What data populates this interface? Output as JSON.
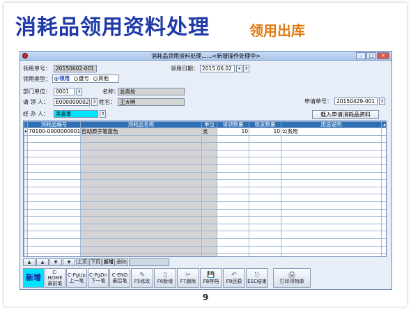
{
  "slide": {
    "title": "消耗品领用资料处理",
    "subtitle": "领用出库",
    "page_number": "9"
  },
  "window": {
    "title": "消耗品领用资料处理......<新增操作处理中>",
    "controls": [
      "minimize-icon",
      "maximize-icon",
      "close-icon"
    ]
  },
  "form": {
    "req_no_label": "领用单号：",
    "req_no_value": "20150602-001",
    "date_label": "领用日期：",
    "date_value": "2015.06.02",
    "type_label": "领用类型：",
    "types": [
      "领用",
      "盘亏",
      "其他"
    ],
    "type_selected": "领用",
    "dept_label": "部门单位：",
    "dept_code": "0001",
    "name_label": "名称：",
    "dept_name": "总务处",
    "applicant_label": "请 领 人：",
    "applicant_code": "E000000002",
    "applicant_name_label": "姓名：",
    "applicant_name": "王大明",
    "handler_label": "经 办 人：",
    "handler_value": "吴嘉豪",
    "apply_no_label": "申请单号：",
    "apply_no_value": "20150429-001",
    "import_button": "载入申请消耗品资料"
  },
  "grid": {
    "columns": [
      "消耗品编号",
      "消耗品名称",
      "单位",
      "请领数量",
      "核发数量",
      "用途说明"
    ],
    "rows": [
      [
        "70100-0000000001",
        "自动原子笔蓝色",
        "支",
        "10",
        "10",
        "公务用"
      ]
    ],
    "empty_rows": 17
  },
  "nav": {
    "arrows": [
      "▲",
      "▲",
      "▼",
      "▼"
    ],
    "page_up": "上页",
    "page_down": "下页",
    "add": "新增",
    "delete": "删除"
  },
  "toolbar": {
    "new": "新增",
    "buttons": [
      {
        "top": "C-HOME",
        "bottom": "最前笔"
      },
      {
        "top": "C-PgUp",
        "bottom": "上一笔"
      },
      {
        "top": "C-PgDn",
        "bottom": "下一笔"
      },
      {
        "top": "C-END",
        "bottom": "最后笔"
      }
    ],
    "actions": [
      {
        "icon": "✎",
        "label": "F5修改"
      },
      {
        "icon": "▯",
        "label": "F6新增"
      },
      {
        "icon": "✂",
        "label": "F7删除"
      },
      {
        "icon": "💾",
        "label": "F8存档"
      },
      {
        "icon": "↶",
        "label": "F9还原"
      },
      {
        "icon": "⎋",
        "label": "ESC结束"
      },
      {
        "icon": "🖨",
        "label": "打印领物单"
      }
    ]
  }
}
